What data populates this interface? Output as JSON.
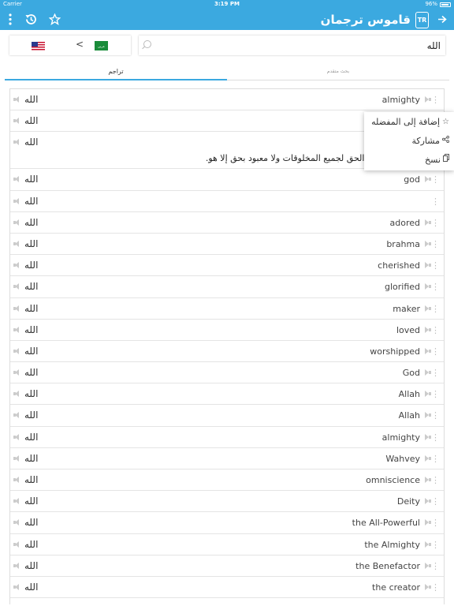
{
  "status_bar": {
    "carrier": "Carrier",
    "time": "3:19 PM",
    "battery": "96%"
  },
  "navbar": {
    "title": "قاموس ترجمان",
    "logo_text": "TR",
    "icons": [
      "more-vert-icon",
      "history-icon",
      "star-icon",
      "arrow-right-icon"
    ]
  },
  "languages": {
    "from_flag": "us-flag",
    "separator": "<",
    "to_flag": "sa-flag",
    "to_flag_text": "عربي"
  },
  "search": {
    "value": "الله"
  },
  "tabs": {
    "translations": "تراجم",
    "advanced": "بحث متقدم"
  },
  "results": [
    {
      "en": "almighty",
      "ar": "الله"
    },
    {
      "en": "",
      "ar": "الله"
    },
    {
      "en": "",
      "ar": "الله",
      "definition": "اسم علم يعني الإله الحق لجميع المخلوقات ولا معبود بحق إلا هو."
    },
    {
      "en": "god",
      "ar": "الله"
    },
    {
      "en": "",
      "ar": "الله"
    },
    {
      "en": "adored",
      "ar": "الله"
    },
    {
      "en": "brahma",
      "ar": "الله"
    },
    {
      "en": "cherished",
      "ar": "الله"
    },
    {
      "en": "glorified",
      "ar": "الله"
    },
    {
      "en": "maker",
      "ar": "الله"
    },
    {
      "en": "loved",
      "ar": "الله"
    },
    {
      "en": "worshipped",
      "ar": "الله"
    },
    {
      "en": "God",
      "ar": "الله"
    },
    {
      "en": "Allah",
      "ar": "الله"
    },
    {
      "en": "Allah",
      "ar": "الله"
    },
    {
      "en": "almighty",
      "ar": "الله"
    },
    {
      "en": "Wahvey",
      "ar": "الله"
    },
    {
      "en": "omniscience",
      "ar": "الله"
    },
    {
      "en": "Deity",
      "ar": "الله"
    },
    {
      "en": "the All-Powerful",
      "ar": "الله"
    },
    {
      "en": "the Almighty",
      "ar": "الله"
    },
    {
      "en": "the Benefactor",
      "ar": "الله"
    },
    {
      "en": "the creator",
      "ar": "الله"
    }
  ],
  "popup_menu": [
    {
      "label": "إضافة إلى المفضله",
      "icon": "star-outline-icon"
    },
    {
      "label": "مشاركة",
      "icon": "share-icon"
    },
    {
      "label": "نسخ",
      "icon": "copy-icon"
    }
  ]
}
